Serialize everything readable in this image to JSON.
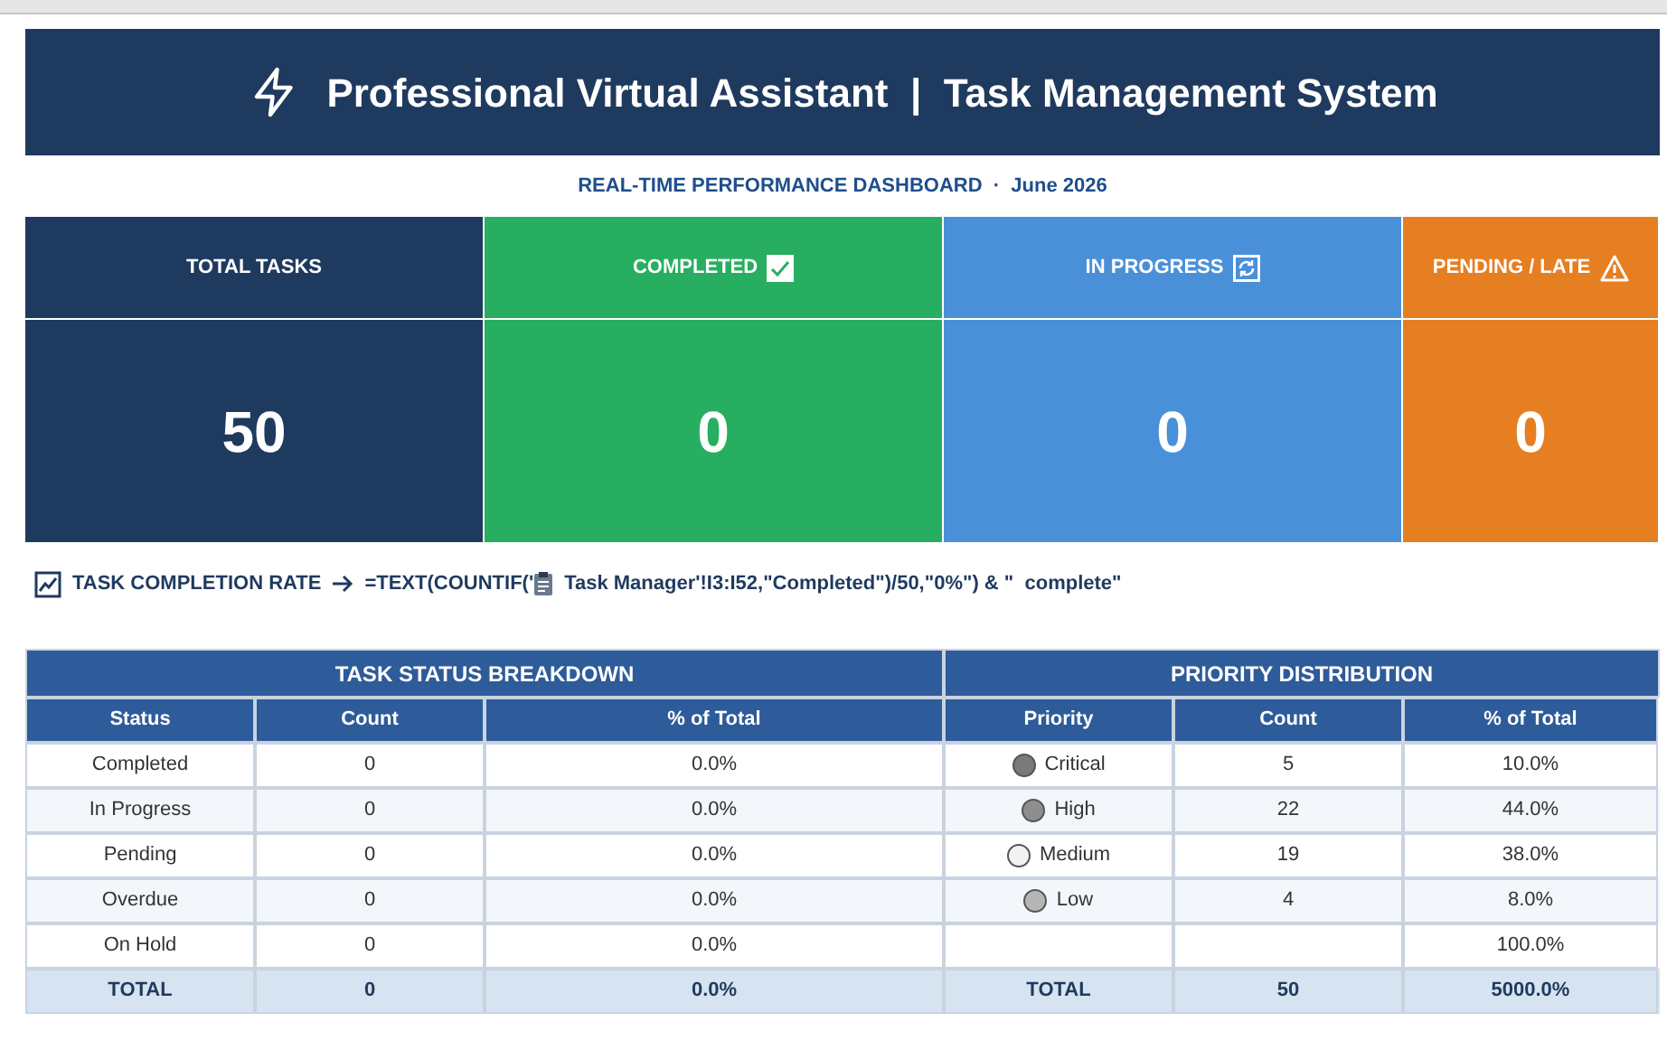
{
  "title": "Professional Virtual Assistant  |  Task Management System",
  "subtitle": "REAL-TIME PERFORMANCE DASHBOARD  ·  June 2026",
  "kpis": [
    {
      "kind": "total",
      "label": "TOTAL TASKS",
      "value": "50",
      "color": "#1f3a5f"
    },
    {
      "kind": "completed",
      "label": "COMPLETED",
      "value": "0",
      "color": "#27ae60"
    },
    {
      "kind": "progress",
      "label": "IN PROGRESS",
      "value": "0",
      "color": "#4a90d9"
    },
    {
      "kind": "pending",
      "label": "PENDING / LATE",
      "value": "0",
      "color": "#e67e22"
    }
  ],
  "completion_rate": {
    "label": "TASK COMPLETION RATE",
    "formula_start": "=TEXT(COUNTIF('",
    "formula_end": "Task Manager'!I3:I52,\"Completed\")/50,\"0%\") & \"  complete\""
  },
  "status_table": {
    "title": "TASK STATUS BREAKDOWN",
    "columns": [
      "Status",
      "Count",
      "% of Total"
    ],
    "rows": [
      [
        "Completed",
        "0",
        "0.0%"
      ],
      [
        "In Progress",
        "0",
        "0.0%"
      ],
      [
        "Pending",
        "0",
        "0.0%"
      ],
      [
        "Overdue",
        "0",
        "0.0%"
      ],
      [
        "On Hold",
        "0",
        "0.0%"
      ]
    ],
    "total": [
      "TOTAL",
      "0",
      "0.0%"
    ]
  },
  "priority_table": {
    "title": "PRIORITY DISTRIBUTION",
    "columns": [
      "Priority",
      "Count",
      "% of Total"
    ],
    "rows": [
      {
        "priority": "Critical",
        "color": "#7a7a7a",
        "count": "5",
        "percent": "10.0%"
      },
      {
        "priority": "High",
        "color": "#8e8e8e",
        "count": "22",
        "percent": "44.0%"
      },
      {
        "priority": "Medium",
        "color": "#f2f2f2",
        "count": "19",
        "percent": "38.0%"
      },
      {
        "priority": "Low",
        "color": "#b5b5b5",
        "count": "4",
        "percent": "8.0%"
      },
      {
        "percent": "100.0%"
      }
    ],
    "total": [
      "TOTAL",
      "50",
      "5000.0%"
    ]
  }
}
